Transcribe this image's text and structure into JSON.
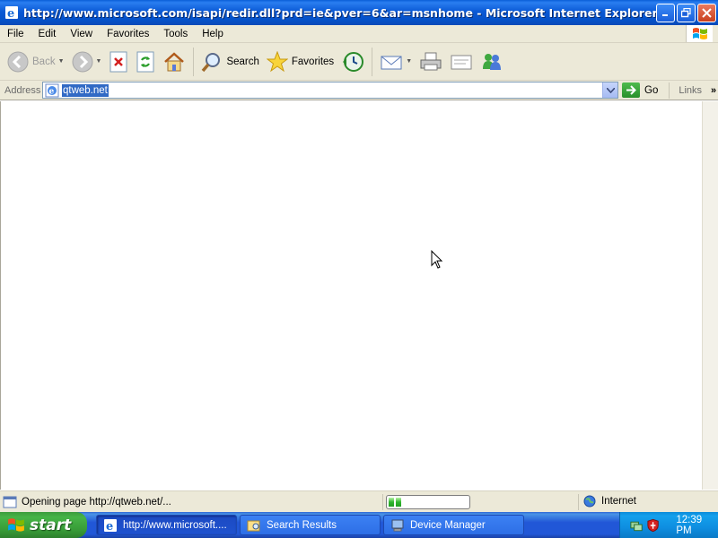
{
  "window": {
    "title": "http://www.microsoft.com/isapi/redir.dll?prd=ie&pver=6&ar=msnhome - Microsoft Internet Explorer"
  },
  "menu": [
    "File",
    "Edit",
    "View",
    "Favorites",
    "Tools",
    "Help"
  ],
  "toolbar": {
    "back": "Back",
    "search": "Search",
    "favorites": "Favorites"
  },
  "address": {
    "label": "Address",
    "value": "qtweb.net",
    "go": "Go",
    "links": "Links"
  },
  "status": {
    "text": "Opening page http://qtweb.net/...",
    "progress": 0.2,
    "zone": "Internet"
  },
  "taskbar": {
    "start": "start",
    "tasks": [
      {
        "label": "http://www.microsoft....",
        "icon": "ie-icon",
        "active": true
      },
      {
        "label": "Search Results",
        "icon": "folder-search-icon",
        "active": false
      },
      {
        "label": "Device Manager",
        "icon": "computer-icon",
        "active": false
      }
    ],
    "clock": "12:39 PM"
  },
  "colors": {
    "titlebar": "#0b5ad6",
    "chrome": "#ece9d8",
    "selection": "#316ac5",
    "start": "#3c9c3c",
    "taskbar": "#2157d7",
    "tray": "#0e8ee0"
  }
}
